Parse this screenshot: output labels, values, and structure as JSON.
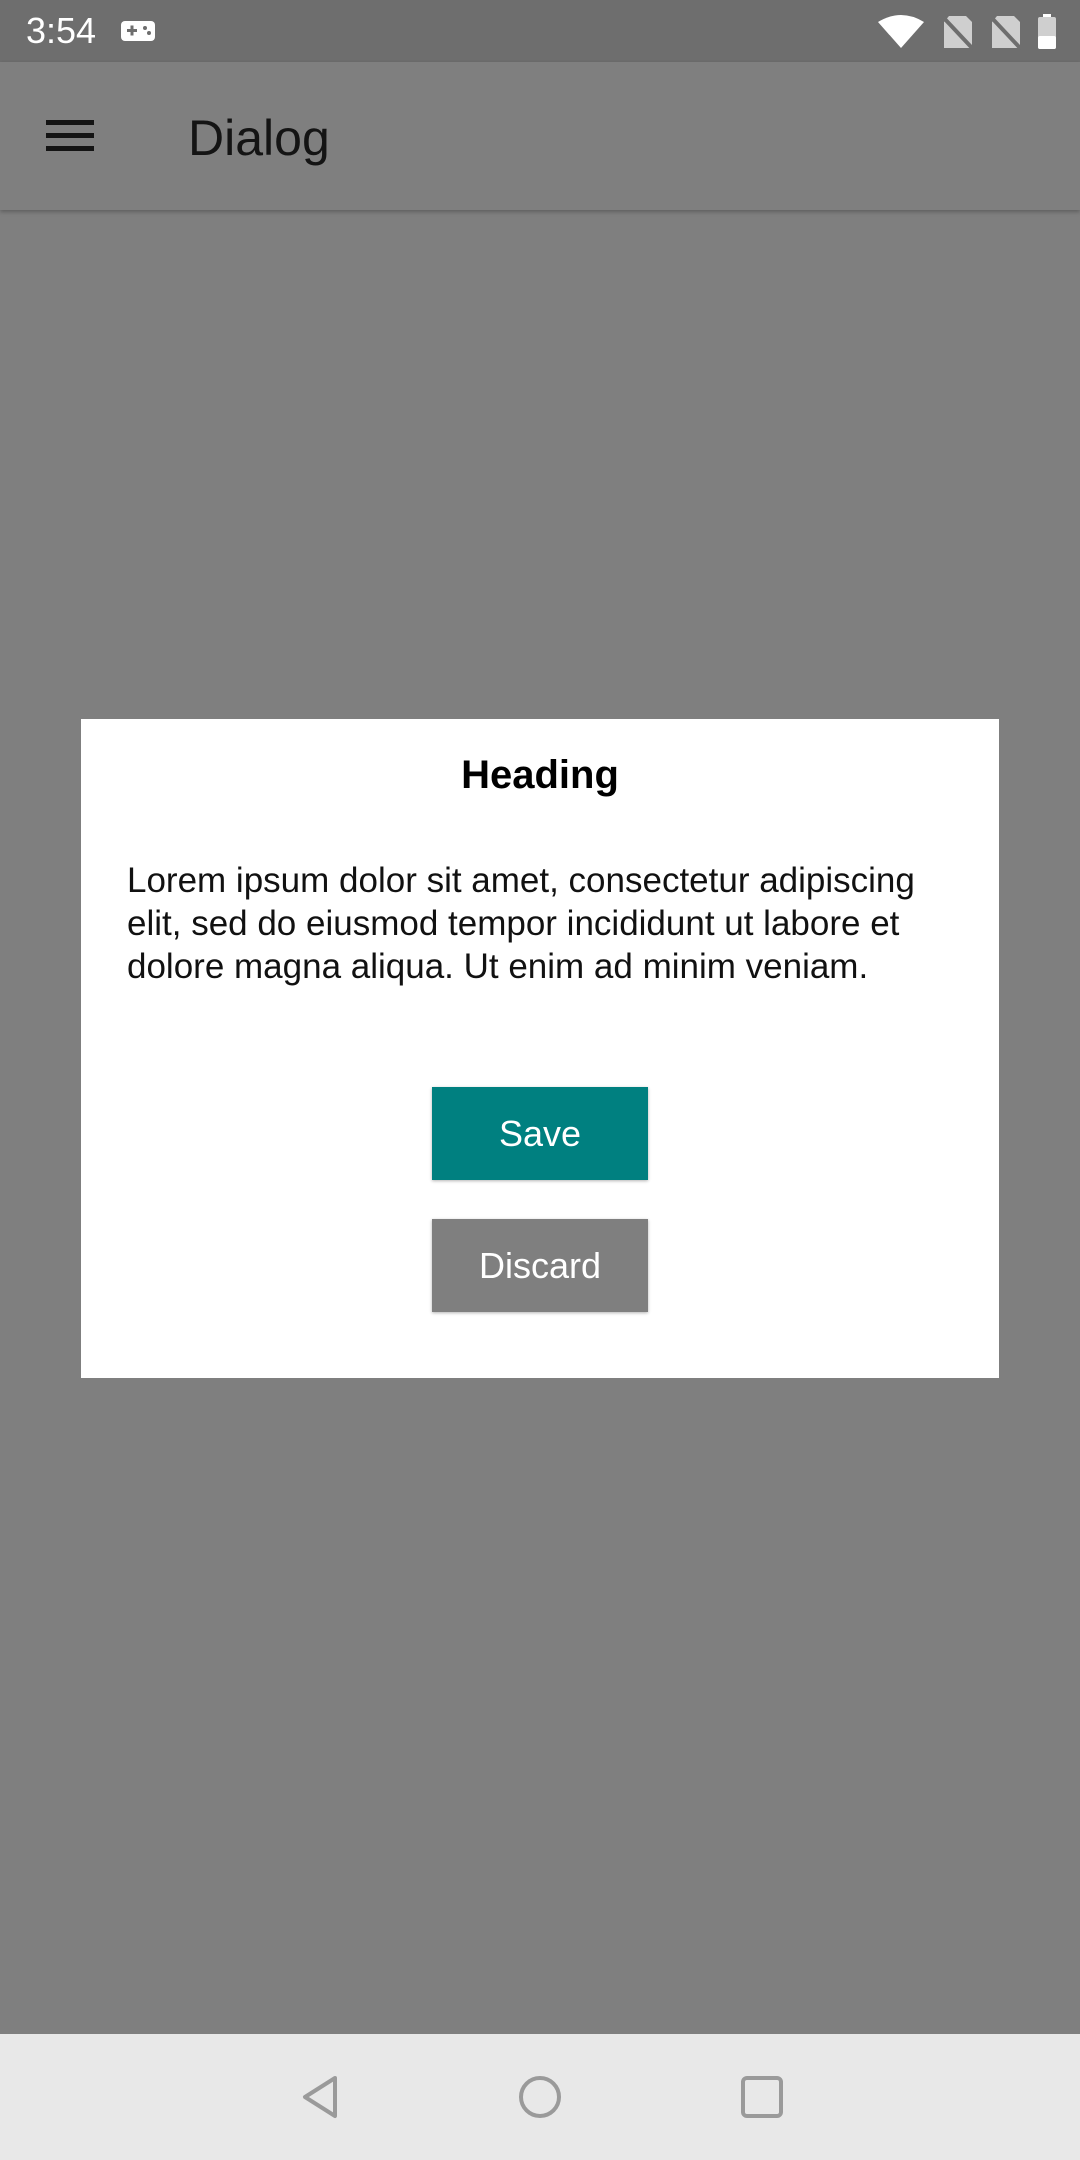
{
  "status_bar": {
    "time": "3:54",
    "icons": [
      "game-controller-icon",
      "wifi-icon",
      "no-sim-icon",
      "no-sim-icon",
      "battery-icon"
    ]
  },
  "app_bar": {
    "title": "Dialog",
    "menu_icon": "hamburger-menu-icon"
  },
  "dialog": {
    "heading": "Heading",
    "body": "Lorem ipsum dolor sit amet, consectetur adipiscing elit, sed do eiusmod tempor incididunt ut labore et dolore magna aliqua. Ut enim ad minim veniam.",
    "save_label": "Save",
    "discard_label": "Discard"
  },
  "nav_bar": {
    "icons": [
      "back-icon",
      "home-icon",
      "recents-icon"
    ]
  },
  "colors": {
    "scrim": "#7f7f7f",
    "primary_button": "#008080",
    "secondary_button": "#7f7f7f",
    "dialog_background": "#ffffff",
    "nav_bar": "#e8e8e8"
  }
}
